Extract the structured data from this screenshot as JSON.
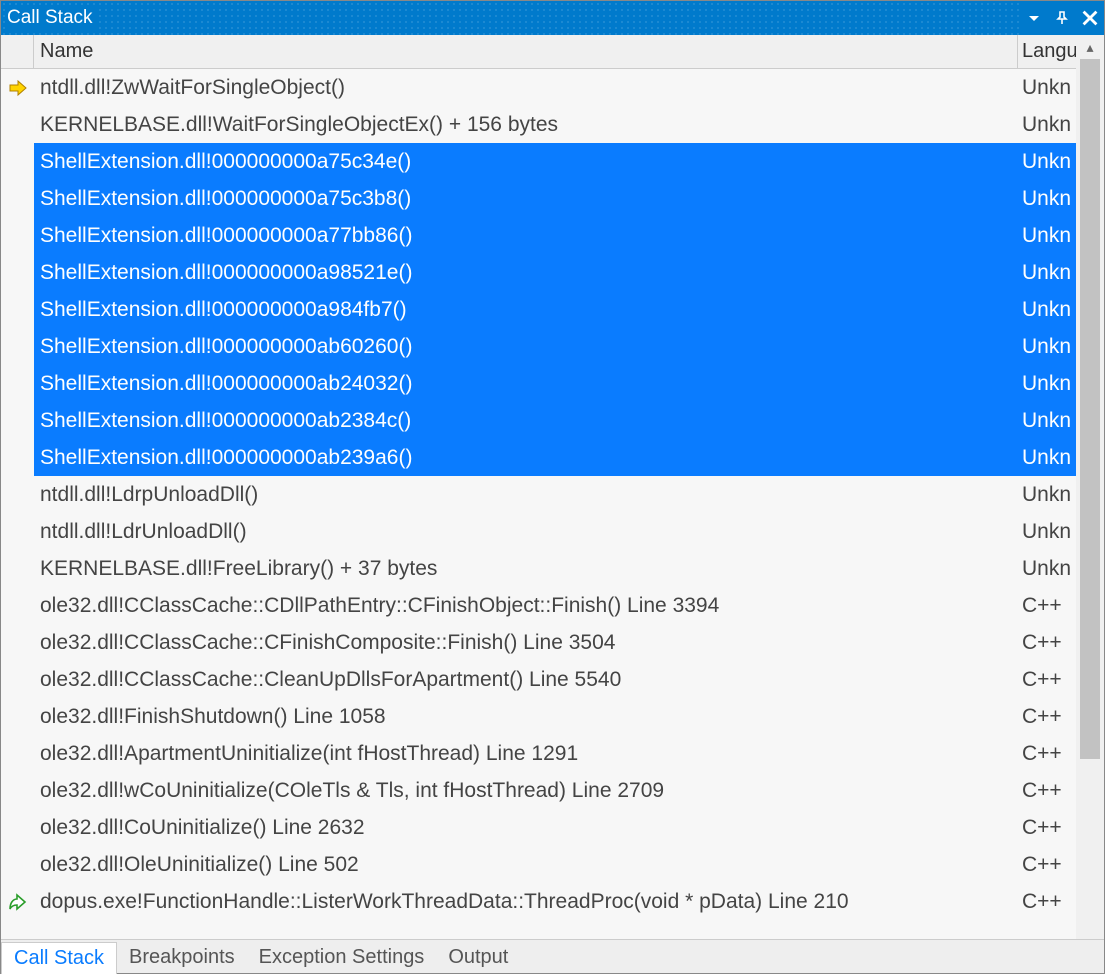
{
  "window": {
    "title": "Call Stack"
  },
  "columns": {
    "name": "Name",
    "lang": "Langu"
  },
  "rows": [
    {
      "icon": "current",
      "name": "ntdll.dll!ZwWaitForSingleObject()",
      "lang": "Unkn",
      "selected": false
    },
    {
      "icon": "",
      "name": "KERNELBASE.dll!WaitForSingleObjectEx() + 156 bytes",
      "lang": "Unkn",
      "selected": false
    },
    {
      "icon": "",
      "name": "ShellExtension.dll!000000000a75c34e()",
      "lang": "Unkn",
      "selected": true
    },
    {
      "icon": "",
      "name": "ShellExtension.dll!000000000a75c3b8()",
      "lang": "Unkn",
      "selected": true
    },
    {
      "icon": "",
      "name": "ShellExtension.dll!000000000a77bb86()",
      "lang": "Unkn",
      "selected": true
    },
    {
      "icon": "",
      "name": "ShellExtension.dll!000000000a98521e()",
      "lang": "Unkn",
      "selected": true
    },
    {
      "icon": "",
      "name": "ShellExtension.dll!000000000a984fb7()",
      "lang": "Unkn",
      "selected": true
    },
    {
      "icon": "",
      "name": "ShellExtension.dll!000000000ab60260()",
      "lang": "Unkn",
      "selected": true
    },
    {
      "icon": "",
      "name": "ShellExtension.dll!000000000ab24032()",
      "lang": "Unkn",
      "selected": true
    },
    {
      "icon": "",
      "name": "ShellExtension.dll!000000000ab2384c()",
      "lang": "Unkn",
      "selected": true
    },
    {
      "icon": "",
      "name": "ShellExtension.dll!000000000ab239a6()",
      "lang": "Unkn",
      "selected": true
    },
    {
      "icon": "",
      "name": "ntdll.dll!LdrpUnloadDll()",
      "lang": "Unkn",
      "selected": false
    },
    {
      "icon": "",
      "name": "ntdll.dll!LdrUnloadDll()",
      "lang": "Unkn",
      "selected": false
    },
    {
      "icon": "",
      "name": "KERNELBASE.dll!FreeLibrary() + 37 bytes",
      "lang": "Unkn",
      "selected": false
    },
    {
      "icon": "",
      "name": "ole32.dll!CClassCache::CDllPathEntry::CFinishObject::Finish() Line 3394",
      "lang": "C++",
      "selected": false
    },
    {
      "icon": "",
      "name": "ole32.dll!CClassCache::CFinishComposite::Finish() Line 3504",
      "lang": "C++",
      "selected": false
    },
    {
      "icon": "",
      "name": "ole32.dll!CClassCache::CleanUpDllsForApartment() Line 5540",
      "lang": "C++",
      "selected": false
    },
    {
      "icon": "",
      "name": "ole32.dll!FinishShutdown() Line 1058",
      "lang": "C++",
      "selected": false
    },
    {
      "icon": "",
      "name": "ole32.dll!ApartmentUninitialize(int fHostThread) Line 1291",
      "lang": "C++",
      "selected": false
    },
    {
      "icon": "",
      "name": "ole32.dll!wCoUninitialize(COleTls & Tls, int fHostThread) Line 2709",
      "lang": "C++",
      "selected": false
    },
    {
      "icon": "",
      "name": "ole32.dll!CoUninitialize() Line 2632",
      "lang": "C++",
      "selected": false
    },
    {
      "icon": "",
      "name": "ole32.dll!OleUninitialize() Line 502",
      "lang": "C++",
      "selected": false
    },
    {
      "icon": "return",
      "name": "dopus.exe!FunctionHandle::ListerWorkThreadData::ThreadProc(void * pData) Line 210",
      "lang": "C++",
      "selected": false
    }
  ],
  "tabs": [
    {
      "label": "Call Stack",
      "active": true
    },
    {
      "label": "Breakpoints",
      "active": false
    },
    {
      "label": "Exception Settings",
      "active": false
    },
    {
      "label": "Output",
      "active": false
    }
  ]
}
